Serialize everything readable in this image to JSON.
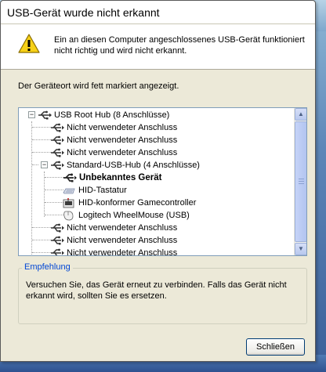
{
  "window": {
    "title": "USB-Gerät wurde nicht erkannt",
    "message": "Ein an diesen Computer angeschlossenes USB-Gerät  funktioniert nicht richtig und wird nicht erkannt.",
    "location_label": "Der Geräteort wird fett markiert angezeigt."
  },
  "tree": {
    "items": [
      {
        "label": "USB Root Hub (8 Anschlüsse)",
        "icon": "usb-icon"
      },
      {
        "label": "Nicht verwendeter Anschluss",
        "icon": "usb-icon"
      },
      {
        "label": "Nicht verwendeter Anschluss",
        "icon": "usb-icon"
      },
      {
        "label": "Nicht verwendeter Anschluss",
        "icon": "usb-icon"
      },
      {
        "label": "Standard-USB-Hub (4 Anschlüsse)",
        "icon": "usb-icon"
      },
      {
        "label": "Unbekanntes Gerät",
        "icon": "usb-icon",
        "bold": true
      },
      {
        "label": "HID-Tastatur",
        "icon": "keyboard-icon"
      },
      {
        "label": "HID-konformer Gamecontroller",
        "icon": "gamecontroller-icon"
      },
      {
        "label": "Logitech WheelMouse (USB)",
        "icon": "mouse-icon"
      },
      {
        "label": "Nicht verwendeter Anschluss",
        "icon": "usb-icon"
      },
      {
        "label": "Nicht verwendeter Anschluss",
        "icon": "usb-icon"
      },
      {
        "label": "Nicht verwendeter Anschluss",
        "icon": "usb-icon"
      }
    ],
    "expander_root": "−",
    "expander_hub": "−"
  },
  "recommendation": {
    "legend": "Empfehlung",
    "text": "Versuchen Sie, das Gerät erneut zu verbinden. Falls das Gerät nicht erkannt wird, sollten Sie es ersetzen."
  },
  "buttons": {
    "close_label": "Schließen"
  },
  "scrollbar": {
    "up_arrow": "▲",
    "down_arrow": "▼"
  },
  "colors": {
    "dialog_bg": "#ece9d8",
    "group_legend": "#0046d5",
    "button_border": "#003c74"
  }
}
